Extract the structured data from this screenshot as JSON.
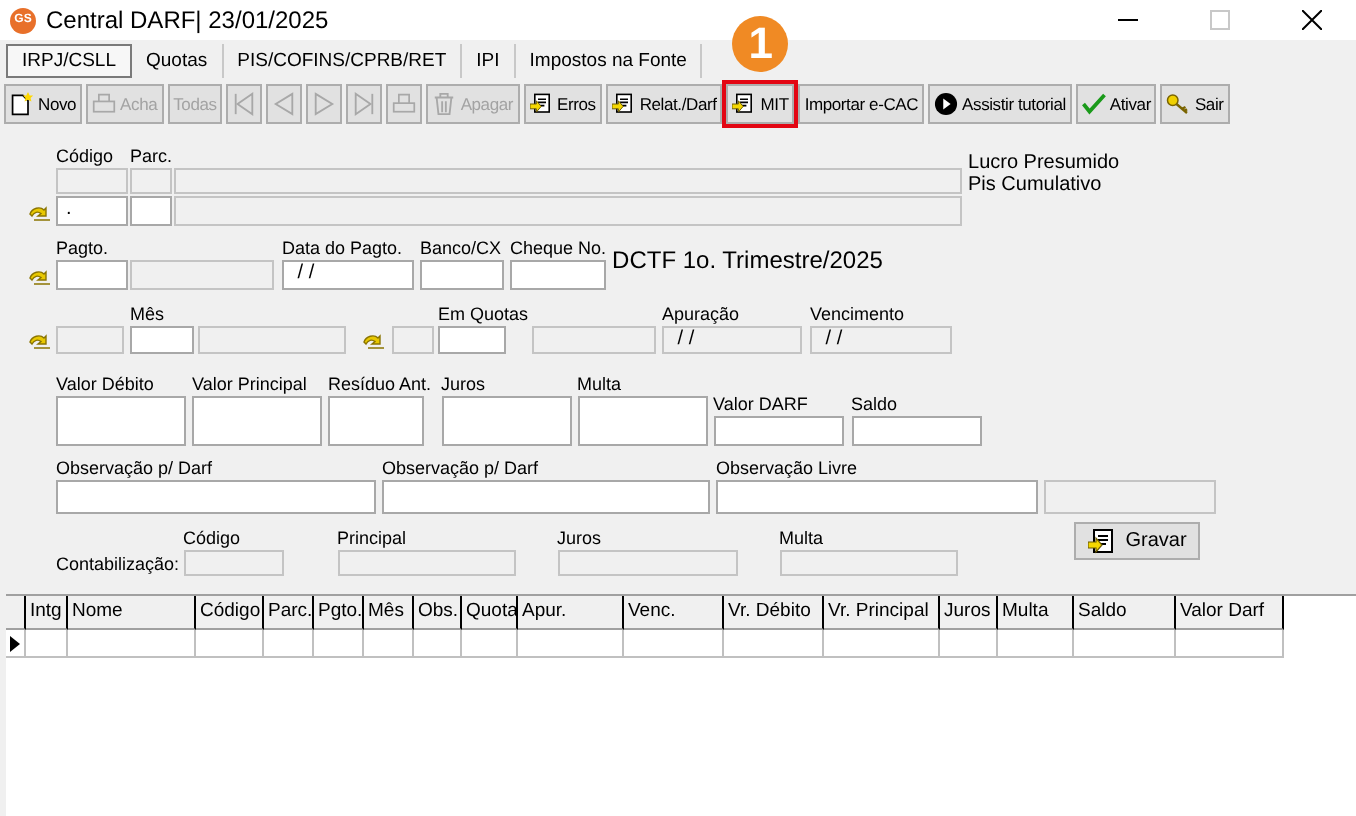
{
  "window": {
    "icon_text": "GS",
    "title": "Central DARF| 23/01/2025"
  },
  "tabs": [
    {
      "label": "IRPJ/CSLL",
      "selected": true
    },
    {
      "label": "Quotas",
      "selected": false
    },
    {
      "label": "PIS/COFINS/CPRB/RET",
      "selected": false
    },
    {
      "label": "IPI",
      "selected": false
    },
    {
      "label": "Impostos na Fonte",
      "selected": false
    }
  ],
  "toolbar": [
    {
      "kind": "new",
      "label": "Novo",
      "disabled": false,
      "highlighted": false
    },
    {
      "kind": "find",
      "label": "Acha",
      "disabled": true,
      "highlighted": false
    },
    {
      "kind": "text",
      "label": "Todas",
      "disabled": true,
      "highlighted": false
    },
    {
      "kind": "first",
      "disabled": true,
      "highlighted": false
    },
    {
      "kind": "prev",
      "disabled": true,
      "highlighted": false
    },
    {
      "kind": "next",
      "disabled": true,
      "highlighted": false
    },
    {
      "kind": "last",
      "disabled": true,
      "highlighted": false
    },
    {
      "kind": "print",
      "disabled": true,
      "highlighted": false
    },
    {
      "kind": "trash",
      "label": "Apagar",
      "disabled": true,
      "highlighted": false
    },
    {
      "kind": "report",
      "label": "Erros",
      "disabled": false,
      "highlighted": false
    },
    {
      "kind": "report",
      "label": "Relat./Darf",
      "disabled": false,
      "highlighted": false
    },
    {
      "kind": "report",
      "label": "MIT",
      "disabled": false,
      "highlighted": true,
      "callout": "1"
    },
    {
      "kind": "text",
      "label": "Importar e-CAC",
      "disabled": false,
      "highlighted": false
    },
    {
      "kind": "play",
      "label": "Assistir tutorial",
      "disabled": false,
      "highlighted": false
    },
    {
      "kind": "check",
      "label": "Ativar",
      "disabled": false,
      "highlighted": false
    },
    {
      "kind": "key",
      "label": "Sair",
      "disabled": false,
      "highlighted": false
    }
  ],
  "tax_regime": [
    "Lucro Presumido",
    "Pis Cumulativo"
  ],
  "heading": "DCTF 1o. Trimestre/2025",
  "form_rows": [
    {
      "items": [
        {
          "kind": "field",
          "label": "Código",
          "disabled": true
        },
        {
          "kind": "field",
          "label": "Parc.",
          "disabled": true
        },
        {
          "kind": "field",
          "disabled": true
        }
      ]
    },
    {
      "items": [
        {
          "kind": "lookup"
        },
        {
          "kind": "field",
          "value": ".",
          "disabled": false
        },
        {
          "kind": "field",
          "disabled": false
        },
        {
          "kind": "field",
          "disabled": true
        }
      ]
    },
    {
      "items": [
        {
          "kind": "lookup"
        },
        {
          "kind": "field",
          "label": "Pagto.",
          "disabled": false
        },
        {
          "kind": "field",
          "disabled": true
        },
        {
          "kind": "field",
          "label": "Data do Pagto.",
          "value": " / /",
          "disabled": false
        },
        {
          "kind": "field",
          "label": "Banco/CX",
          "disabled": false
        },
        {
          "kind": "field",
          "label": "Cheque No.",
          "disabled": false
        }
      ]
    },
    {
      "items": [
        {
          "kind": "lookup"
        },
        {
          "kind": "field",
          "disabled": true
        },
        {
          "kind": "field",
          "label": "Mês",
          "disabled": false
        },
        {
          "kind": "field",
          "disabled": true
        },
        {
          "kind": "lookup"
        },
        {
          "kind": "field",
          "disabled": true
        },
        {
          "kind": "field",
          "label": "Em Quotas",
          "disabled": false
        },
        {
          "kind": "field",
          "disabled": true
        },
        {
          "kind": "field",
          "label": "Apuração",
          "value": " / /",
          "disabled": true
        },
        {
          "kind": "field",
          "label": "Vencimento",
          "value": " / /",
          "disabled": true
        }
      ]
    },
    {
      "items": [
        {
          "kind": "field",
          "label": "Valor Débito",
          "disabled": false
        },
        {
          "kind": "field",
          "label": "Valor Principal",
          "disabled": false
        },
        {
          "kind": "field",
          "label": "Resíduo Ant.",
          "disabled": false
        },
        {
          "kind": "field",
          "label": "Juros",
          "disabled": false
        },
        {
          "kind": "field",
          "label": "Multa",
          "disabled": false
        },
        {
          "kind": "field",
          "label": "Valor DARF",
          "disabled": false
        },
        {
          "kind": "field",
          "label": "Saldo",
          "disabled": false
        }
      ]
    },
    {
      "items": [
        {
          "kind": "field",
          "label": "Observação p/ Darf",
          "disabled": false
        },
        {
          "kind": "field",
          "label": "Observação p/ Darf",
          "disabled": false
        },
        {
          "kind": "field",
          "label": "Observação Livre",
          "disabled": false
        },
        {
          "kind": "field",
          "disabled": true
        }
      ]
    }
  ],
  "accounting": {
    "label": "Contabilização:",
    "fields": [
      {
        "label": "Código",
        "disabled": true
      },
      {
        "label": "Principal",
        "disabled": true
      },
      {
        "label": "Juros",
        "disabled": true
      },
      {
        "label": "Multa",
        "disabled": true
      }
    ]
  },
  "save_button": {
    "label": "Gravar"
  },
  "grid": {
    "columns": [
      "Intg",
      "Nome",
      "Código",
      "Parc.",
      "Pgto.",
      "Mês",
      "Obs.",
      "Quota",
      "Apur.",
      "Venc.",
      "Vr. Débito",
      "Vr. Principal",
      "Juros",
      "Multa",
      "Saldo",
      "Valor Darf"
    ]
  }
}
